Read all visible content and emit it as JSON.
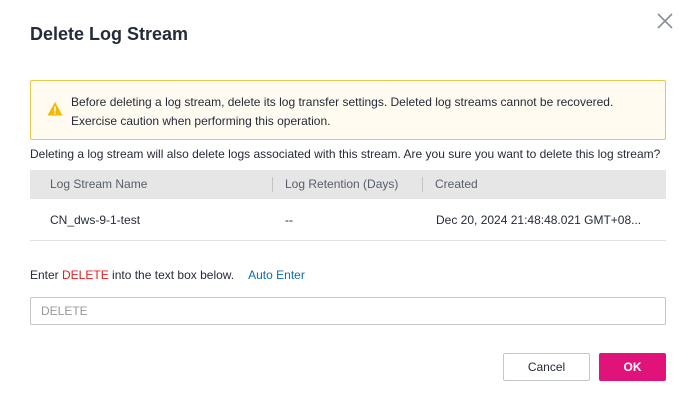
{
  "dialog": {
    "title": "Delete Log Stream",
    "close_icon": "close-icon"
  },
  "warning": {
    "icon": "warning-icon",
    "text": "Before deleting a log stream, delete its log transfer settings. Deleted log streams cannot be recovered. Exercise caution when performing this operation.",
    "border_color": "#e6c84b",
    "background_color": "#fffbf0",
    "icon_color": "#f5b800"
  },
  "confirm_text": "Deleting a log stream will also delete logs associated with this stream. Are you sure you want to delete this log stream?",
  "table": {
    "columns": [
      "Log Stream Name",
      "Log Retention (Days)",
      "Created"
    ],
    "rows": [
      [
        "CN_dws-9-1-test",
        "--",
        "Dec 20, 2024 21:48:48.021 GMT+08..."
      ]
    ]
  },
  "enter_prompt": {
    "prefix": "Enter ",
    "keyword": "DELETE",
    "suffix": " into the text box below.",
    "auto_enter_label": "Auto Enter"
  },
  "input": {
    "placeholder": "DELETE",
    "value": ""
  },
  "buttons": {
    "cancel_label": "Cancel",
    "ok_label": "OK"
  },
  "colors": {
    "primary": "#e0137a",
    "link": "#0a6eb5",
    "danger_text": "#e02020"
  }
}
